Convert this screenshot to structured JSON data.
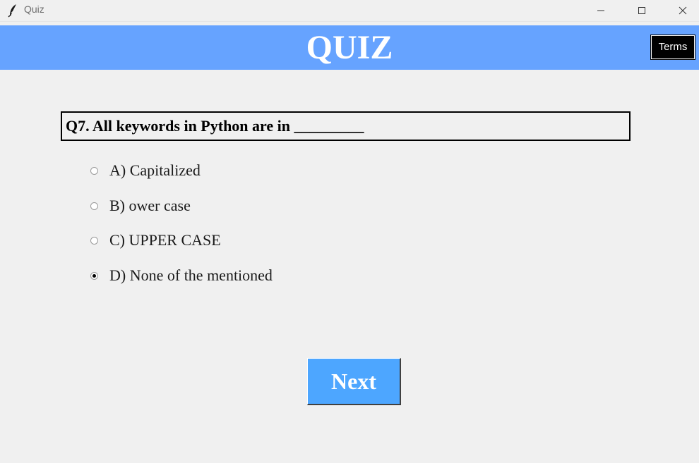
{
  "window": {
    "title": "Quiz",
    "app_icon": "feather-icon"
  },
  "header": {
    "heading": "QUIZ",
    "bg_color": "#66a3ff",
    "terms_label": "Terms"
  },
  "question": {
    "text": "Q7. All keywords in Python are in _________"
  },
  "options": [
    {
      "label": "A) Capitalized",
      "selected": false
    },
    {
      "label": "B) ower case",
      "selected": false
    },
    {
      "label": "C) UPPER CASE",
      "selected": false
    },
    {
      "label": "D) None of the mentioned",
      "selected": true
    }
  ],
  "next": {
    "label": "Next",
    "bg_color": "#4da6ff"
  }
}
